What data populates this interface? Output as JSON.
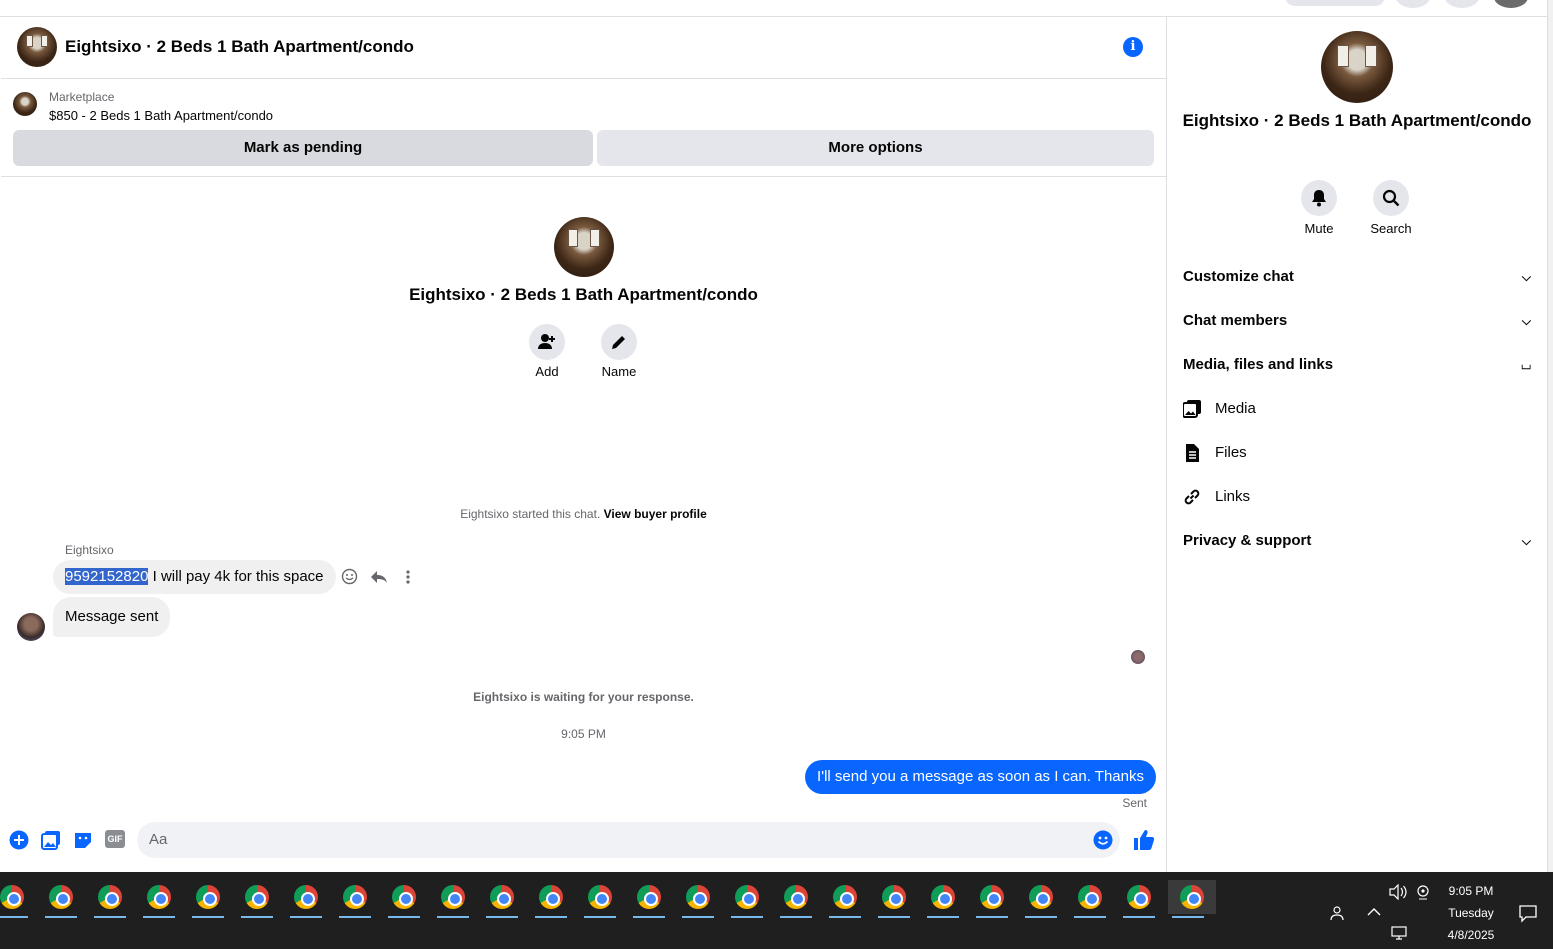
{
  "header": {
    "title": "Eightsixo · 2 Beds 1 Bath Apartment/condo"
  },
  "marketplace": {
    "label": "Marketplace",
    "price_line": "$850 - 2 Beds 1 Bath Apartment/condo",
    "pending_label": "Mark as pending",
    "more_label": "More options"
  },
  "intro": {
    "title": "Eightsixo · 2 Beds 1 Bath Apartment/condo",
    "add_label": "Add",
    "name_label": "Name"
  },
  "thread": {
    "started_text": "Eightsixo started this chat.",
    "buyer_profile_link": "View buyer profile",
    "sender_name": "Eightsixo",
    "msg1_phone": "9592152820",
    "msg1_text": " I will pay 4k for this space",
    "msg2_text": "Message sent",
    "waiting_text": "Eightsixo is waiting for your response.",
    "timestamp": "9:05 PM",
    "reply_text": "I'll send you a message as soon as I can. Thanks",
    "reply_status": "Sent"
  },
  "composer": {
    "placeholder": "Aa"
  },
  "sidebar": {
    "title": "Eightsixo · 2 Beds 1 Bath Apartment/condo",
    "mute_label": "Mute",
    "search_label": "Search",
    "sections": [
      {
        "label": "Customize chat",
        "expanded": false
      },
      {
        "label": "Chat members",
        "expanded": false
      },
      {
        "label": "Media, files and links",
        "expanded": true
      },
      {
        "label": "Privacy & support",
        "expanded": false
      }
    ],
    "media_items": [
      {
        "label": "Media",
        "icon": "media-icon"
      },
      {
        "label": "Files",
        "icon": "file-icon"
      },
      {
        "label": "Links",
        "icon": "link-icon"
      }
    ]
  },
  "taskbar": {
    "time": "9:05 PM",
    "day": "Tuesday",
    "date": "4/8/2025",
    "app_count": 25
  },
  "colors": {
    "accent": "#0866ff",
    "taskbar": "#1f1f1f",
    "bubble_in": "#f0f0f0"
  }
}
